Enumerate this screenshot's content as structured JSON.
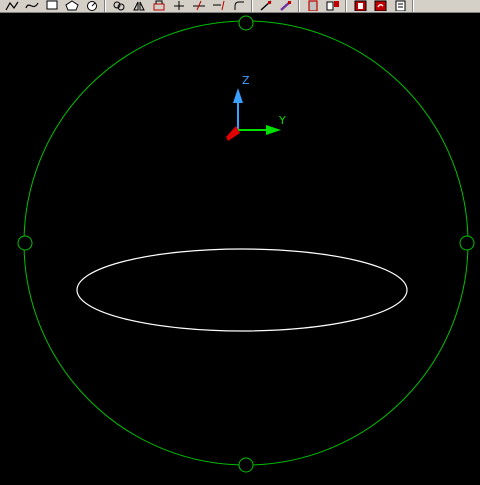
{
  "toolbar": {
    "draw_group": [
      "polyline-icon",
      "spline-icon",
      "rectangle-icon",
      "polygon-icon",
      "circle-center-icon"
    ],
    "modify_group": [
      "copy-icon",
      "mirror-icon",
      "stretch-icon",
      "move-icon",
      "trim-icon",
      "extend-icon",
      "fillet-icon"
    ],
    "edit_group": [
      "pencil-icon",
      "eraser-icon"
    ],
    "view_group": [
      "section-icon",
      "explode-icon"
    ],
    "render_group": [
      "render-icon",
      "undo-render-icon",
      "properties-icon"
    ]
  },
  "viewport": {
    "background": "#000000",
    "sphere_color": "#00c000",
    "profile_color": "#ffffff",
    "ucs_icon": {
      "z_label": "Z",
      "y_label": "Y",
      "z_color": "#3aa0ff",
      "y_color": "#00e000",
      "x_color": "#e00000"
    },
    "grips": [
      "top-grip",
      "left-grip",
      "right-grip",
      "bottom-grip"
    ]
  }
}
